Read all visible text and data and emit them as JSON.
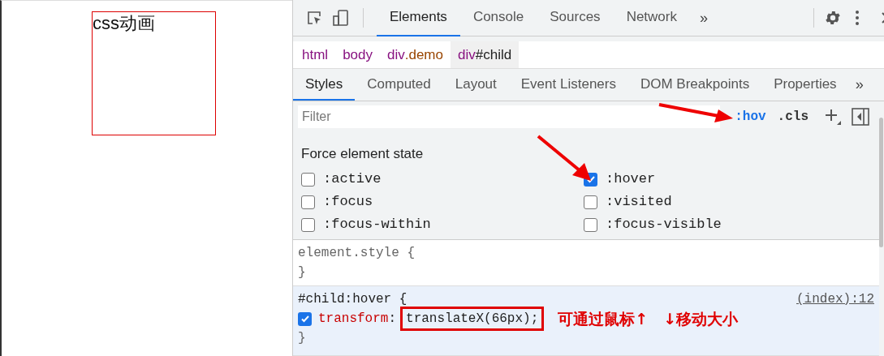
{
  "page": {
    "demo_text": "css动画"
  },
  "toolbar": {
    "tabs": [
      {
        "label": "Elements",
        "selected": true
      },
      {
        "label": "Console",
        "selected": false
      },
      {
        "label": "Sources",
        "selected": false
      },
      {
        "label": "Network",
        "selected": false
      }
    ],
    "more": "»"
  },
  "breadcrumb": [
    {
      "tag": "html",
      "kind": "tag",
      "selected": false
    },
    {
      "tag": "body",
      "kind": "tag",
      "selected": false
    },
    {
      "tag": "div",
      "suffix": ".demo",
      "kind": "class",
      "selected": false
    },
    {
      "tag": "div",
      "suffix": "#child",
      "kind": "id",
      "selected": true
    }
  ],
  "subtabs": {
    "tabs": [
      {
        "label": "Styles",
        "selected": true
      },
      {
        "label": "Computed",
        "selected": false
      },
      {
        "label": "Layout",
        "selected": false
      },
      {
        "label": "Event Listeners",
        "selected": false
      },
      {
        "label": "DOM Breakpoints",
        "selected": false
      },
      {
        "label": "Properties",
        "selected": false
      }
    ],
    "more": "»"
  },
  "filter": {
    "placeholder": "Filter",
    "buttons": [
      {
        "label": ":hov",
        "selected": true
      },
      {
        "label": ".cls",
        "selected": false
      }
    ]
  },
  "force_state": {
    "title": "Force element state",
    "states": [
      {
        "label": ":active",
        "checked": false
      },
      {
        "label": ":hover",
        "checked": true
      },
      {
        "label": ":focus",
        "checked": false
      },
      {
        "label": ":visited",
        "checked": false
      },
      {
        "label": ":focus-within",
        "checked": false
      },
      {
        "label": ":focus-visible",
        "checked": false
      }
    ]
  },
  "rules": [
    {
      "header": "element.style {",
      "footer": "}",
      "highlighted": false
    },
    {
      "header": "#child:hover {",
      "source": "(index):12",
      "footer": "}",
      "highlighted": true,
      "declarations": [
        {
          "property": "transform",
          "separator": ":",
          "value": "translateX(66px);",
          "enabled": true
        }
      ]
    }
  ],
  "annotation": {
    "text": "可通过鼠标↑　↓移动大小"
  }
}
